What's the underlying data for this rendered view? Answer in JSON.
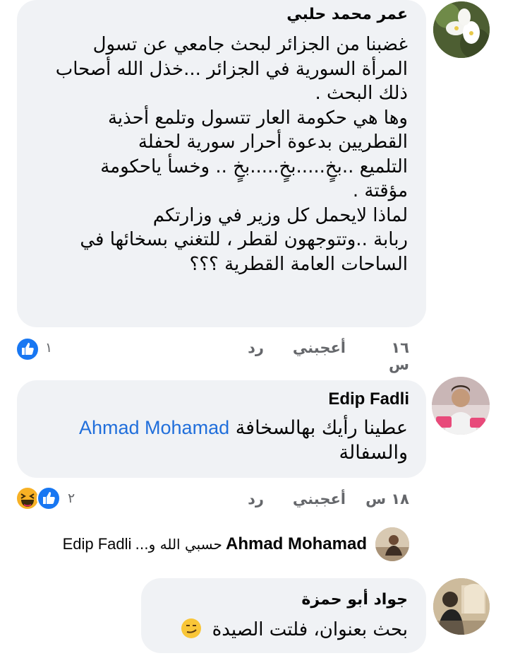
{
  "comments": [
    {
      "author": "عمر محمد حلبي",
      "lines": [
        "غضبنا من الجزائر لبحث جامعي عن تسول",
        "المرأة السورية في الجزائر ...خذل الله أصحاب",
        "ذلك البحث .",
        "وها هي حكومة العار تتسول وتلمع أحذية",
        "القطريين بدعوة أحرار سورية لحفلة",
        "التلميع ..بخٍ.....بخٍ.....بخٍ .. وخسأ ياحكومة",
        "مؤقتة .",
        "لماذا لايحمل كل وزير في وزارتكم",
        "ربابة ..وتتوجهون لقطر ، للتغني بسخائها في",
        "الساحات العامة القطرية ؟؟؟"
      ],
      "time": "١٦ س",
      "like_label": "أعجبني",
      "reply_label": "رد",
      "reaction_count": "١"
    },
    {
      "author": "Edip Fadli",
      "mention": "Ahmad Mohamad",
      "text_line1": "عطينا رأيك بهالسخافة",
      "text_line2": "والسفالة",
      "time": "١٨ س",
      "like_label": "أعجبني",
      "reply_label": "رد",
      "reaction_count": "٢"
    }
  ],
  "reply_preview": {
    "author": "Ahmad Mohamad",
    "snippet": "حسبي الله و...",
    "target": "Edip Fadli"
  },
  "comment3": {
    "author": "جواد أبو حمزة",
    "text": "بحث بعنوان، فلتت الصيدة"
  },
  "colors": {
    "bubble": "#f0f2f5",
    "meta": "#65676b",
    "mention": "#216fdb",
    "like_blue": "#1877f2",
    "haha_yellow": "#f7b125"
  }
}
